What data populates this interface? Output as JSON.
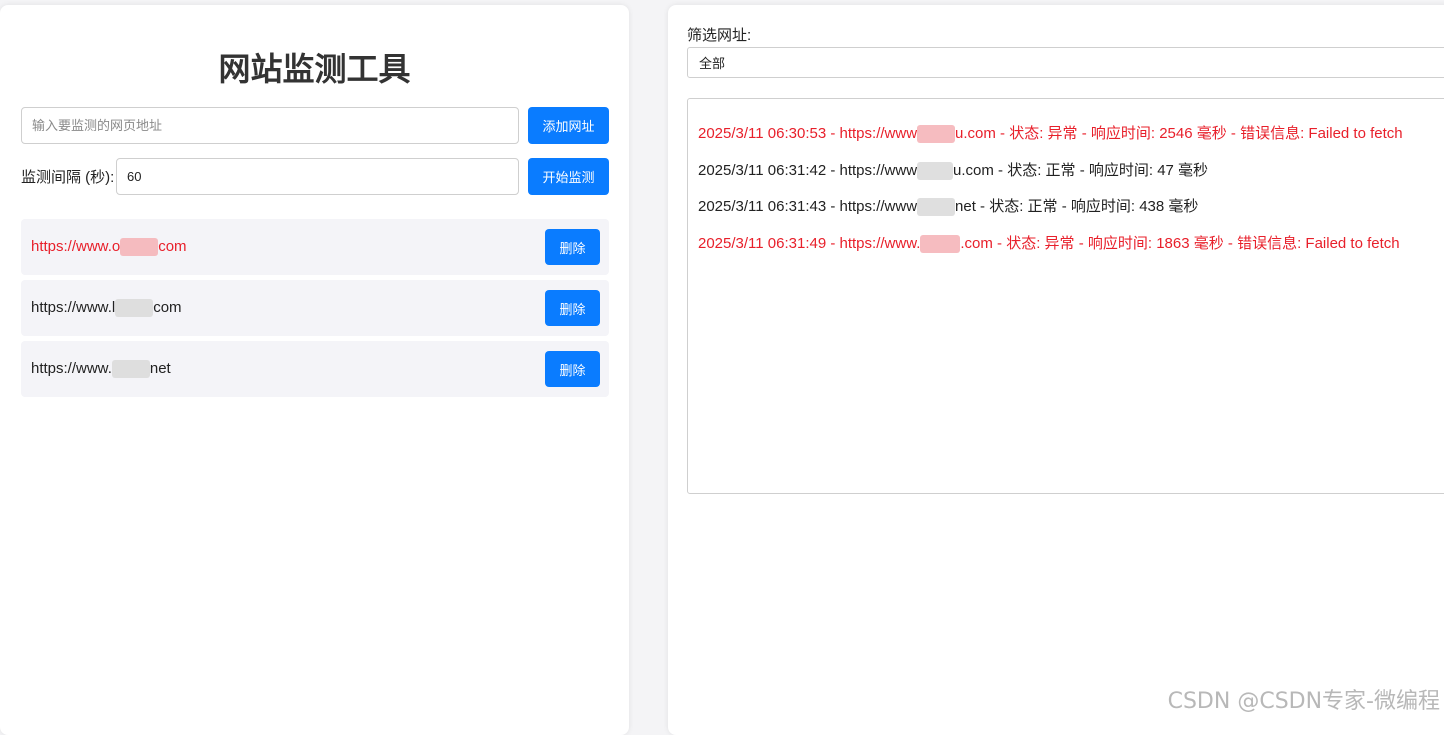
{
  "left": {
    "title": "网站监测工具",
    "url_input": {
      "placeholder": "输入要监测的网页地址",
      "value": ""
    },
    "add_button": "添加网址",
    "interval": {
      "label": "监测间隔 (秒):",
      "value": "60"
    },
    "start_button": "开始监测",
    "sites": [
      {
        "prefix": "https://www.o",
        "suffix": "com",
        "status": "error",
        "delete_label": "删除"
      },
      {
        "prefix": "https://www.l",
        "suffix": "com",
        "status": "normal",
        "delete_label": "删除"
      },
      {
        "prefix": "https://www.",
        "suffix": "net",
        "status": "normal",
        "delete_label": "删除"
      }
    ]
  },
  "right": {
    "filter_label": "筛选网址:",
    "filter_selected": "全部",
    "logs": [
      {
        "prefix": "2025/3/11 06:30:53 - https://www",
        "suffix": "u.com - 状态: 异常 - 响应时间: 2546 毫秒 - 错误信息: Failed to fetch",
        "status": "error"
      },
      {
        "prefix": "2025/3/11 06:31:42 - https://www",
        "suffix": "u.com - 状态: 正常 - 响应时间: 47 毫秒",
        "status": "normal"
      },
      {
        "prefix": "2025/3/11 06:31:43 - https://www",
        "suffix": "net - 状态: 正常 - 响应时间: 438 毫秒",
        "status": "normal"
      },
      {
        "prefix": "2025/3/11 06:31:49 - https://www.",
        "suffix": ".com - 状态: 异常 - 响应时间: 1863 毫秒 - 错误信息: Failed to fetch",
        "status": "error"
      }
    ]
  },
  "watermark": "CSDN @CSDN专家-微编程",
  "colors": {
    "accent": "#0a7cff",
    "error": "#e8202b",
    "item_bg": "#f4f4f8"
  }
}
